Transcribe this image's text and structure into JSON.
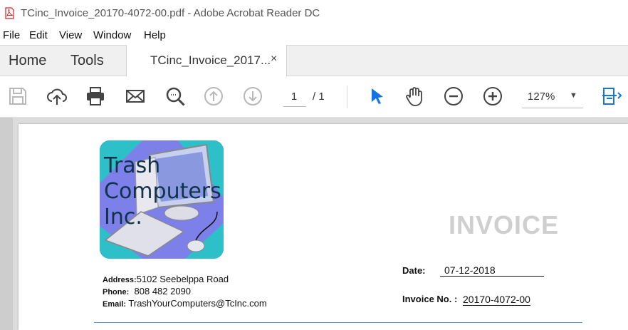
{
  "window": {
    "title": "TCinc_Invoice_20170-4072-00.pdf - Adobe Acrobat Reader DC"
  },
  "menu": [
    "File",
    "Edit",
    "View",
    "Window",
    "Help"
  ],
  "tabs": {
    "home": "Home",
    "tools": "Tools",
    "document": "TCinc_Invoice_2017...",
    "close": "×"
  },
  "toolbar": {
    "page_current": "1",
    "page_total": "/ 1",
    "zoom": "127%"
  },
  "colors": {
    "accent": "#1473e6",
    "icon_gray": "#444444",
    "disabled": "#b8b8b8",
    "invoice_title": "#cfcfcf",
    "rule": "#5b9bd5"
  },
  "icons": [
    "save-icon",
    "upload-icon",
    "print-icon",
    "mail-icon",
    "search-icon",
    "page-up-icon",
    "page-down-icon",
    "select-arrow-icon",
    "hand-icon",
    "zoom-out-icon",
    "zoom-in-icon",
    "fit-page-icon"
  ],
  "document": {
    "logo_lines": [
      "Trash",
      "Computers",
      "Inc."
    ],
    "invoice_heading": "INVOICE",
    "address_label": "Address:",
    "address": "5102 Seebelppa Road",
    "phone_label": "Phone:",
    "phone": "808 482 2090",
    "email_label": "Email:",
    "email": "TrashYourComputers@TcInc.com",
    "date_label": "Date:",
    "date": "07-12-2018",
    "invoice_no_label": "Invoice No. :",
    "invoice_no": "20170-4072-00"
  }
}
